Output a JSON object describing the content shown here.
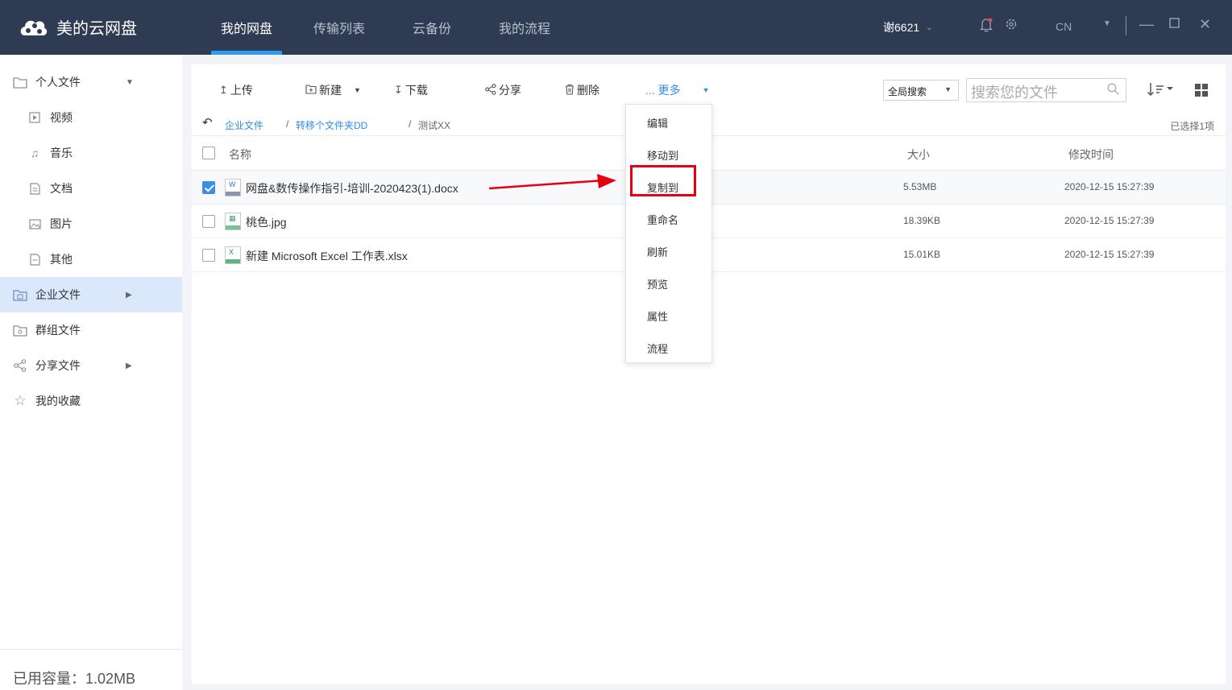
{
  "app": {
    "title": "美的云网盘"
  },
  "nav": {
    "tabs": [
      "我的网盘",
      "传输列表",
      "云备份",
      "我的流程"
    ]
  },
  "user": {
    "name": "谢6621"
  },
  "lang": "CN",
  "sidebar": {
    "items": [
      {
        "label": "个人文件",
        "icon": "folder-icon"
      },
      {
        "label": "视频",
        "icon": "video-icon"
      },
      {
        "label": "音乐",
        "icon": "music-icon"
      },
      {
        "label": "文档",
        "icon": "document-icon"
      },
      {
        "label": "图片",
        "icon": "image-icon"
      },
      {
        "label": "其他",
        "icon": "other-icon"
      },
      {
        "label": "企业文件",
        "icon": "enterprise-folder-icon"
      },
      {
        "label": "群组文件",
        "icon": "group-folder-icon"
      },
      {
        "label": "分享文件",
        "icon": "share-icon"
      },
      {
        "label": "我的收藏",
        "icon": "star-icon"
      }
    ],
    "capacity": "已用容量：1.02MB"
  },
  "toolbar": {
    "upload": "上传",
    "new": "新建",
    "download": "下载",
    "share": "分享",
    "delete": "删除",
    "more": "... 更多",
    "scope": "全局搜索",
    "search_placeholder": "搜索您的文件"
  },
  "breadcrumb": {
    "items": [
      "企业文件",
      "转移个文件夹DD",
      "测试XX"
    ]
  },
  "selection": "已选择1项",
  "table": {
    "headers": {
      "name": "名称",
      "size": "大小",
      "mtime": "修改时间"
    },
    "rows": [
      {
        "name": "网盘&数传操作指引-培训-2020423(1).docx",
        "size": "5.53MB",
        "mtime": "2020-12-15 15:27:39",
        "checked": true,
        "type": "word"
      },
      {
        "name": "桃色.jpg",
        "size": "18.39KB",
        "mtime": "2020-12-15 15:27:39",
        "checked": false,
        "type": "image"
      },
      {
        "name": "新建 Microsoft Excel 工作表.xlsx",
        "size": "15.01KB",
        "mtime": "2020-12-15 15:27:39",
        "checked": false,
        "type": "excel"
      }
    ]
  },
  "context_menu": {
    "items": [
      "编辑",
      "移动到",
      "复制到",
      "重命名",
      "刷新",
      "预览",
      "属性",
      "流程"
    ],
    "highlighted": "复制到"
  },
  "colors": {
    "topbar": "#2f3b52",
    "accent": "#2e8ee8",
    "highlight": "#e60012",
    "active_side": "#dbe8fb"
  }
}
